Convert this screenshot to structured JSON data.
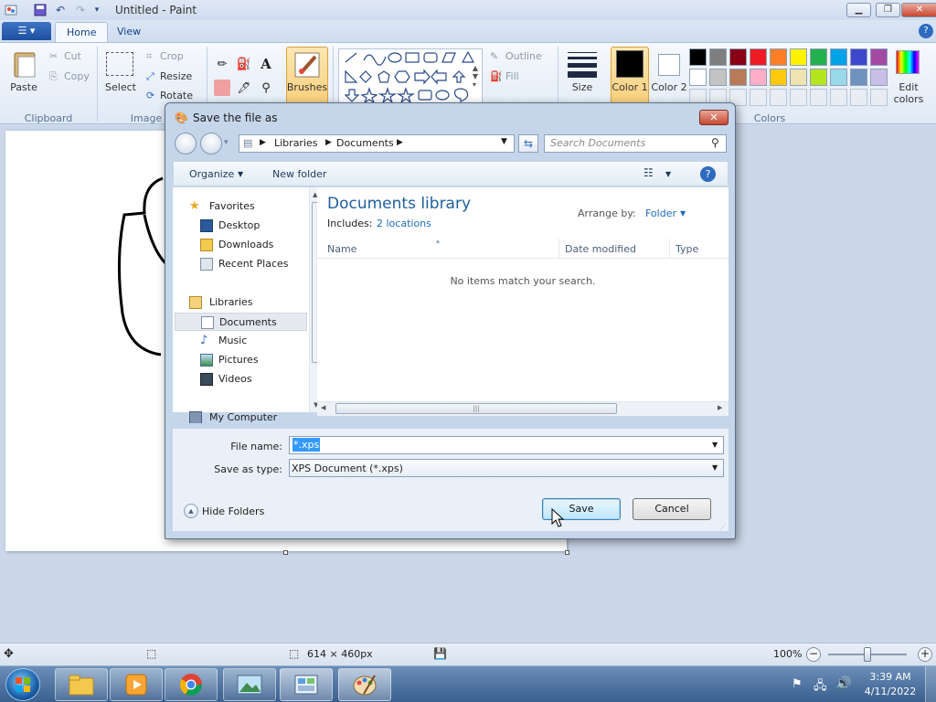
{
  "app": {
    "title": "Untitled - Paint"
  },
  "ribbon": {
    "file_menu": "",
    "tabs": [
      {
        "label": "Home"
      },
      {
        "label": "View"
      }
    ],
    "clipboard": {
      "paste": "Paste",
      "cut": "Cut",
      "copy": "Copy",
      "group": "Clipboard"
    },
    "image": {
      "select": "Select",
      "crop": "Crop",
      "resize": "Resize",
      "rotate": "Rotate",
      "group": "Image"
    },
    "tools": {
      "brushes": "Brushes"
    },
    "shapes": {
      "outline": "Outline",
      "fill": "Fill"
    },
    "size": "Size",
    "color1": "Color 1",
    "color2": "Color 2",
    "colors": {
      "group": "Colors",
      "edit": "Edit colors",
      "palette_row1": [
        "#000000",
        "#7f7f7f",
        "#880015",
        "#ed1c24",
        "#ff7f27",
        "#fff200",
        "#22b14c",
        "#00a2e8",
        "#3f48cc",
        "#a349a4"
      ],
      "palette_row2": [
        "#ffffff",
        "#c3c3c3",
        "#b97a57",
        "#ffaec9",
        "#ffc90e",
        "#efe4b0",
        "#b5e61d",
        "#99d9ea",
        "#7092be",
        "#c8bfe7"
      ]
    }
  },
  "status": {
    "canvas_size": "614 × 460px",
    "zoom": "100%"
  },
  "dialog": {
    "title": "Save the file as",
    "address": {
      "crumbs": [
        "Libraries",
        "Documents"
      ]
    },
    "search_placeholder": "Search Documents",
    "commands": {
      "organize": "Organize",
      "new_folder": "New folder"
    },
    "nav": {
      "favorites": "Favorites",
      "desktop": "Desktop",
      "downloads": "Downloads",
      "recent": "Recent Places",
      "libraries": "Libraries",
      "documents": "Documents",
      "music": "Music",
      "pictures": "Pictures",
      "videos": "Videos",
      "computer": "My Computer"
    },
    "content": {
      "library_title": "Documents library",
      "includes_label": "Includes:",
      "includes_link": "2 locations",
      "arrange_label": "Arrange by:",
      "arrange_value": "Folder",
      "columns": [
        "Name",
        "Date modified",
        "Type"
      ],
      "empty_message": "No items match your search."
    },
    "file_name_label": "File name:",
    "file_name_value": "*.xps",
    "save_type_label": "Save as type:",
    "save_type_value": "XPS Document (*.xps)",
    "hide_folders": "Hide Folders",
    "save_button": "Save",
    "cancel_button": "Cancel"
  },
  "taskbar": {
    "time": "3:39 AM",
    "date": "4/11/2022"
  }
}
